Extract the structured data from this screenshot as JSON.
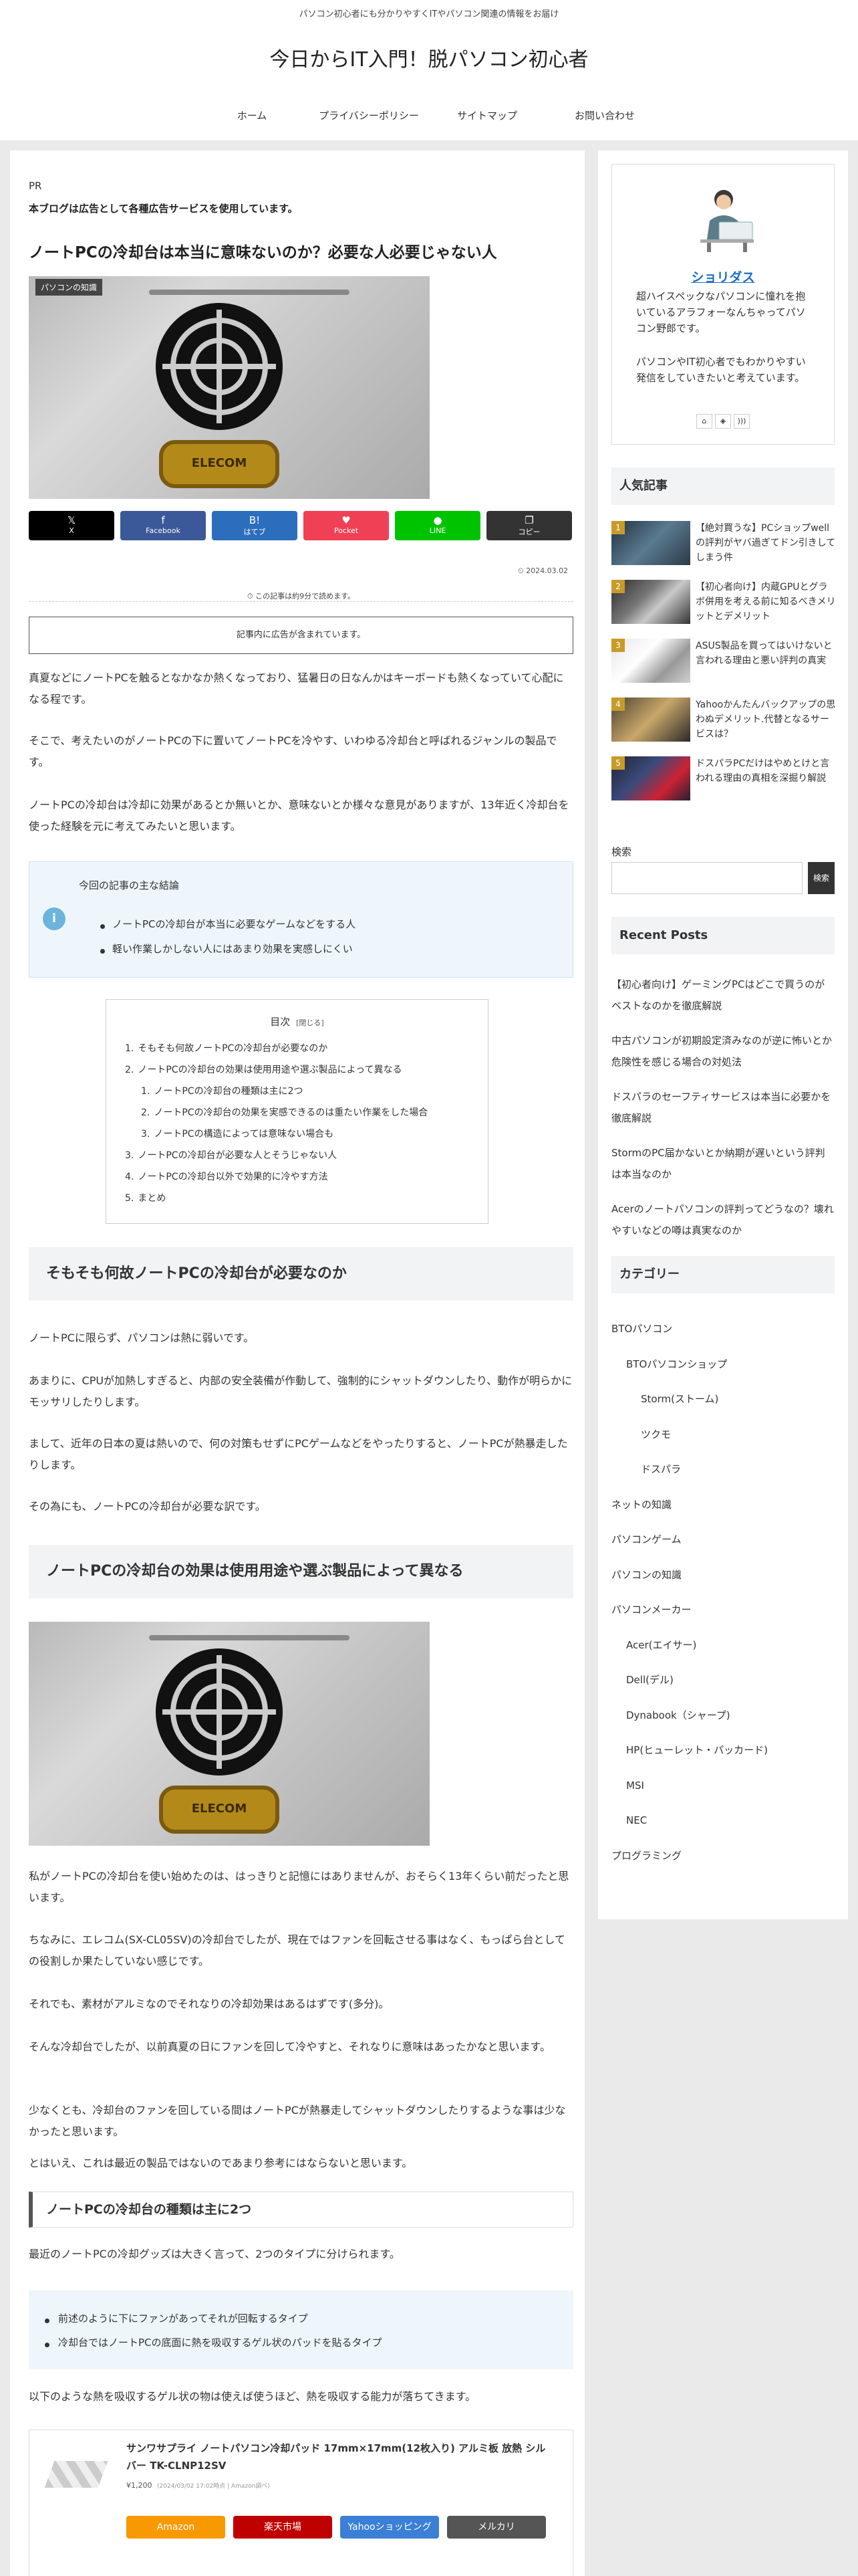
{
  "header": {
    "tagline": "パソコン初心者にも分かりやすくITやパソコン関連の情報をお届け",
    "site_title": "今日からIT入門！脱パソコン初心者",
    "nav": [
      "ホーム",
      "プライバシーポリシー",
      "サイトマップ",
      "お問い合わせ"
    ]
  },
  "article": {
    "pr_label": "PR",
    "pr_notice": "本ブログは広告として各種広告サービスを使用しています。",
    "title": "ノートPCの冷却台は本当に意味ないのか？必要な人必要じゃない人",
    "category_badge": "パソコンの知識",
    "fan_brand": "ELECOM",
    "share": [
      {
        "icon": "x-icon",
        "glyph": "𝕏",
        "label": "X",
        "color": "#000000"
      },
      {
        "icon": "facebook-icon",
        "glyph": "f",
        "label": "Facebook",
        "color": "#3b5998"
      },
      {
        "icon": "hatena-icon",
        "glyph": "B!",
        "label": "はてブ",
        "color": "#2c6ebd"
      },
      {
        "icon": "pocket-icon",
        "glyph": "♥",
        "label": "Pocket",
        "color": "#ef4056"
      },
      {
        "icon": "line-icon",
        "glyph": "●",
        "label": "LINE",
        "color": "#00c300"
      },
      {
        "icon": "copy-icon",
        "glyph": "❐",
        "label": "コピー",
        "color": "#333333"
      }
    ],
    "date": "2024.03.02",
    "read_time": "この記事は約9分で読めます。",
    "ad_notice": "記事内に広告が含まれています。",
    "intro": [
      "真夏などにノートPCを触るとなかなか熱くなっており、猛暑日の日なんかはキーボードも熱くなっていて心配になる程です。",
      "そこで、考えたいのがノートPCの下に置いてノートPCを冷やす、いわゆる冷却台と呼ばれるジャンルの製品です。",
      "ノートPCの冷却台は冷却に効果があるとか無いとか、意味ないとか様々な意見がありますが、13年近く冷却台を使った経験を元に考えてみたいと思います。"
    ],
    "conclusion": {
      "title": "今回の記事の主な結論",
      "items": [
        "ノートPCの冷却台が本当に必要なゲームなどをする人",
        "軽い作業しかしない人にはあまり効果を実感しにくい"
      ]
    },
    "toc": {
      "title": "目次",
      "toggle": "[閉じる]",
      "items": [
        {
          "num": "1.",
          "text": "そもそも何故ノートPCの冷却台が必要なのか",
          "level": 0
        },
        {
          "num": "2.",
          "text": "ノートPCの冷却台の効果は使用用途や選ぶ製品によって異なる",
          "level": 0
        },
        {
          "num": "1.",
          "text": "ノートPCの冷却台の種類は主に2つ",
          "level": 1
        },
        {
          "num": "2.",
          "text": "ノートPCの冷却台の効果を実感できるのは重たい作業をした場合",
          "level": 1
        },
        {
          "num": "3.",
          "text": "ノートPCの構造によっては意味ない場合も",
          "level": 1
        },
        {
          "num": "3.",
          "text": "ノートPCの冷却台が必要な人とそうじゃない人",
          "level": 0
        },
        {
          "num": "4.",
          "text": "ノートPCの冷却台以外で効果的に冷やす方法",
          "level": 0
        },
        {
          "num": "5.",
          "text": "まとめ",
          "level": 0
        }
      ]
    },
    "section1": {
      "heading": "そもそも何故ノートPCの冷却台が必要なのか",
      "paras": [
        "ノートPCに限らず、パソコンは熱に弱いです。",
        "あまりに、CPUが加熱しすぎると、内部の安全装備が作動して、強制的にシャットダウンしたり、動作が明らかにモッサリしたりします。",
        "まして、近年の日本の夏は熱いので、何の対策もせずにPCゲームなどをやったりすると、ノートPCが熱暴走したりします。",
        "その為にも、ノートPCの冷却台が必要な訳です。"
      ]
    },
    "section2": {
      "heading": "ノートPCの冷却台の効果は使用用途や選ぶ製品によって異なる",
      "paras": [
        "私がノートPCの冷却台を使い始めたのは、はっきりと記憶にはありませんが、おそらく13年くらい前だったと思います。",
        "ちなみに、エレコム(SX-CL05SV)の冷却台でしたが、現在ではファンを回転させる事はなく、もっぱら台としての役割しか果たしていない感じです。",
        "それでも、素材がアルミなのでそれなりの冷却効果はあるはずです(多分)。",
        "そんな冷却台でしたが、以前真夏の日にファンを回して冷やすと、それなりに意味はあったかなと思います。",
        "少なくとも、冷却台のファンを回している間はノートPCが熱暴走してシャットダウンしたりするような事は少なかったと思います。",
        "とはいえ、これは最近の製品ではないのであまり参考にはならないと思います。"
      ]
    },
    "section3": {
      "heading": "ノートPCの冷却台の種類は主に2つ",
      "lead": "最近のノートPCの冷却グッズは大きく言って、2つのタイプに分けられます。",
      "items": [
        "前述のように下にファンがあってそれが回転するタイプ",
        "冷却台ではノートPCの底面に熱を吸収するゲル状のパッドを貼るタイプ"
      ],
      "after": "以下のような熱を吸収するゲル状の物は使えば使うほど、熱を吸収する能力が落ちてきます。"
    },
    "product": {
      "title": "サンワサプライ ノートパソコン冷却パッド 17mm×17mm(12枚入り) アルミ板 放熱 シルバー TK-CLNP12SV",
      "price": "¥1,200",
      "price_note": "(2024/03/02 17:02時点 | Amazon調べ)",
      "buttons": [
        {
          "label": "Amazon",
          "color": "#f79901"
        },
        {
          "label": "楽天市場",
          "color": "#bf0000"
        },
        {
          "label": "Yahooショッピング",
          "color": "#3b7fd6"
        },
        {
          "label": "メルカリ",
          "color": "#555555"
        }
      ]
    }
  },
  "sidebar": {
    "profile": {
      "name": "ショリダス",
      "bio": [
        "超ハイスペックなパソコンに憧れを抱いているアラフォーなんちゃってパソコン野郎です。",
        "パソコンやIT初心者でもわかりやすい発信をしていきたいと考えています。"
      ],
      "icons": [
        "home-icon",
        "feedly-icon",
        "rss-icon"
      ]
    },
    "popular_heading": "人気記事",
    "popular": [
      {
        "rank": "1",
        "title": "【絶対買うな】PCショップwellの評判がヤバ過ぎてドン引きしてしまう件"
      },
      {
        "rank": "2",
        "title": "【初心者向け】内蔵GPUとグラボ併用を考える前に知るべきメリットとデメリット"
      },
      {
        "rank": "3",
        "title": "ASUS製品を買ってはいけないと言われる理由と悪い評判の真実"
      },
      {
        "rank": "4",
        "title": "Yahooかんたんバックアップの思わぬデメリット.代替となるサービスは？"
      },
      {
        "rank": "5",
        "title": "ドスパラPCだけはやめとけと言われる理由の真相を深掘り解説"
      }
    ],
    "search_label": "検索",
    "search_button": "検索",
    "recent_heading": "Recent Posts",
    "recent": [
      "【初心者向け】ゲーミングPCはどこで買うのがベストなのかを徹底解説",
      "中古パソコンが初期設定済みなのが逆に怖いとか危険性を感じる場合の対処法",
      "ドスパラのセーフティサービスは本当に必要かを徹底解説",
      "StormのPC届かないとか納期が遅いという評判は本当なのか",
      "Acerのノートパソコンの評判ってどうなの？壊れやすいなどの噂は真実なのか"
    ],
    "category_heading": "カテゴリー",
    "categories": [
      {
        "label": "BTOパソコン",
        "level": 0
      },
      {
        "label": "BTOパソコンショップ",
        "level": 1
      },
      {
        "label": "Storm(ストーム)",
        "level": 2
      },
      {
        "label": "ツクモ",
        "level": 2
      },
      {
        "label": "ドスパラ",
        "level": 2
      },
      {
        "label": "ネットの知識",
        "level": 0
      },
      {
        "label": "パソコンゲーム",
        "level": 0
      },
      {
        "label": "パソコンの知識",
        "level": 0
      },
      {
        "label": "パソコンメーカー",
        "level": 0
      },
      {
        "label": "Acer(エイサー)",
        "level": 1
      },
      {
        "label": "Dell(デル)",
        "level": 1
      },
      {
        "label": "Dynabook（シャープ)",
        "level": 1
      },
      {
        "label": "HP(ヒューレット・パッカード)",
        "level": 1
      },
      {
        "label": "MSI",
        "level": 1
      },
      {
        "label": "NEC",
        "level": 1
      },
      {
        "label": "プログラミング",
        "level": 0
      }
    ]
  }
}
